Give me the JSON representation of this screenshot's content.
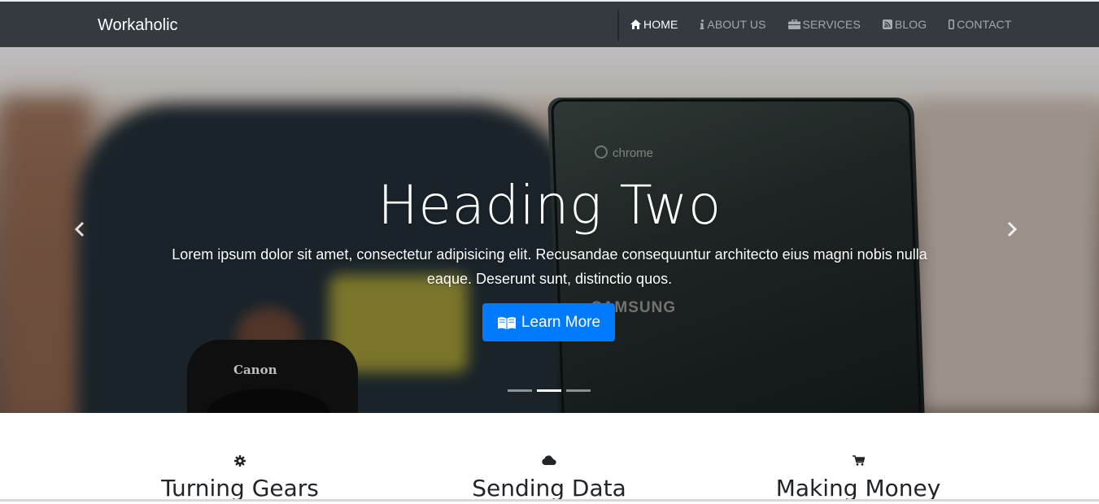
{
  "navbar": {
    "brand": "Workaholic",
    "links": [
      {
        "label": "HOME",
        "icon": "home-icon",
        "active": true
      },
      {
        "label": "ABOUT US",
        "icon": "info-icon",
        "active": false
      },
      {
        "label": "SERVICES",
        "icon": "briefcase-icon",
        "active": false
      },
      {
        "label": "BLOG",
        "icon": "rss-icon",
        "active": false
      },
      {
        "label": "CONTACT",
        "icon": "mobile-icon",
        "active": false
      }
    ]
  },
  "hero": {
    "photo_text": {
      "chrome": "chrome",
      "samsung": "SAMSUNG",
      "canon": "Canon"
    },
    "heading": "Heading Two",
    "text": "Lorem ipsum dolor sit amet, consectetur adipisicing elit. Recusandae consequuntur architecto eius magni nobis nulla eaque. Deserunt sunt, distinctio quos.",
    "button_label": "Learn More",
    "button_icon": "book-open-icon",
    "slides": 3,
    "active_slide": 2
  },
  "features": [
    {
      "title": "Turning Gears",
      "icon": "gear-icon"
    },
    {
      "title": "Sending Data",
      "icon": "cloud-icon"
    },
    {
      "title": "Making Money",
      "icon": "cart-icon"
    }
  ],
  "colors": {
    "navbar": "#343a40",
    "primary": "#007bff",
    "text": "#212529"
  }
}
